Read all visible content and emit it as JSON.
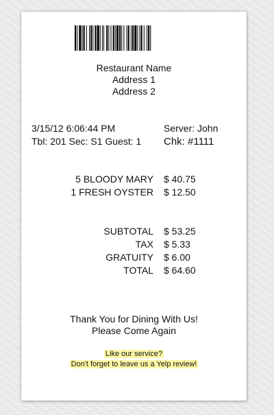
{
  "restaurant": {
    "name": "Restaurant Name",
    "address1": "Address 1",
    "address2": "Address 2"
  },
  "check": {
    "datetime": "3/15/12 6:06:44 PM",
    "table_line": "Tbl: 201 Sec: S1  Guest: 1",
    "server": "Server: John",
    "check_number": "Chk:  #1111"
  },
  "items": [
    {
      "description": "5 BLOODY MARY",
      "amount": "$ 40.75"
    },
    {
      "description": "1 FRESH OYSTER",
      "amount": "$ 12.50"
    }
  ],
  "totals": [
    {
      "label": "SUBTOTAL",
      "amount": "$ 53.25"
    },
    {
      "label": "TAX",
      "amount": "$ 5.33"
    },
    {
      "label": "GRATUITY",
      "amount": "$ 6.00"
    },
    {
      "label": "TOTAL",
      "amount": "$ 64.60"
    }
  ],
  "footer": {
    "thanks": "Thank You for Dining With Us!",
    "come_again": "Please Come Again",
    "promo_line1": "Like our service?",
    "promo_line2": "Don't forget to leave us a Yelp review!"
  },
  "colors": {
    "highlight": "#fbf7a4",
    "paper": "#ffffff",
    "background": "#e9e9e9"
  },
  "icons": {
    "barcode": "barcode-icon"
  }
}
